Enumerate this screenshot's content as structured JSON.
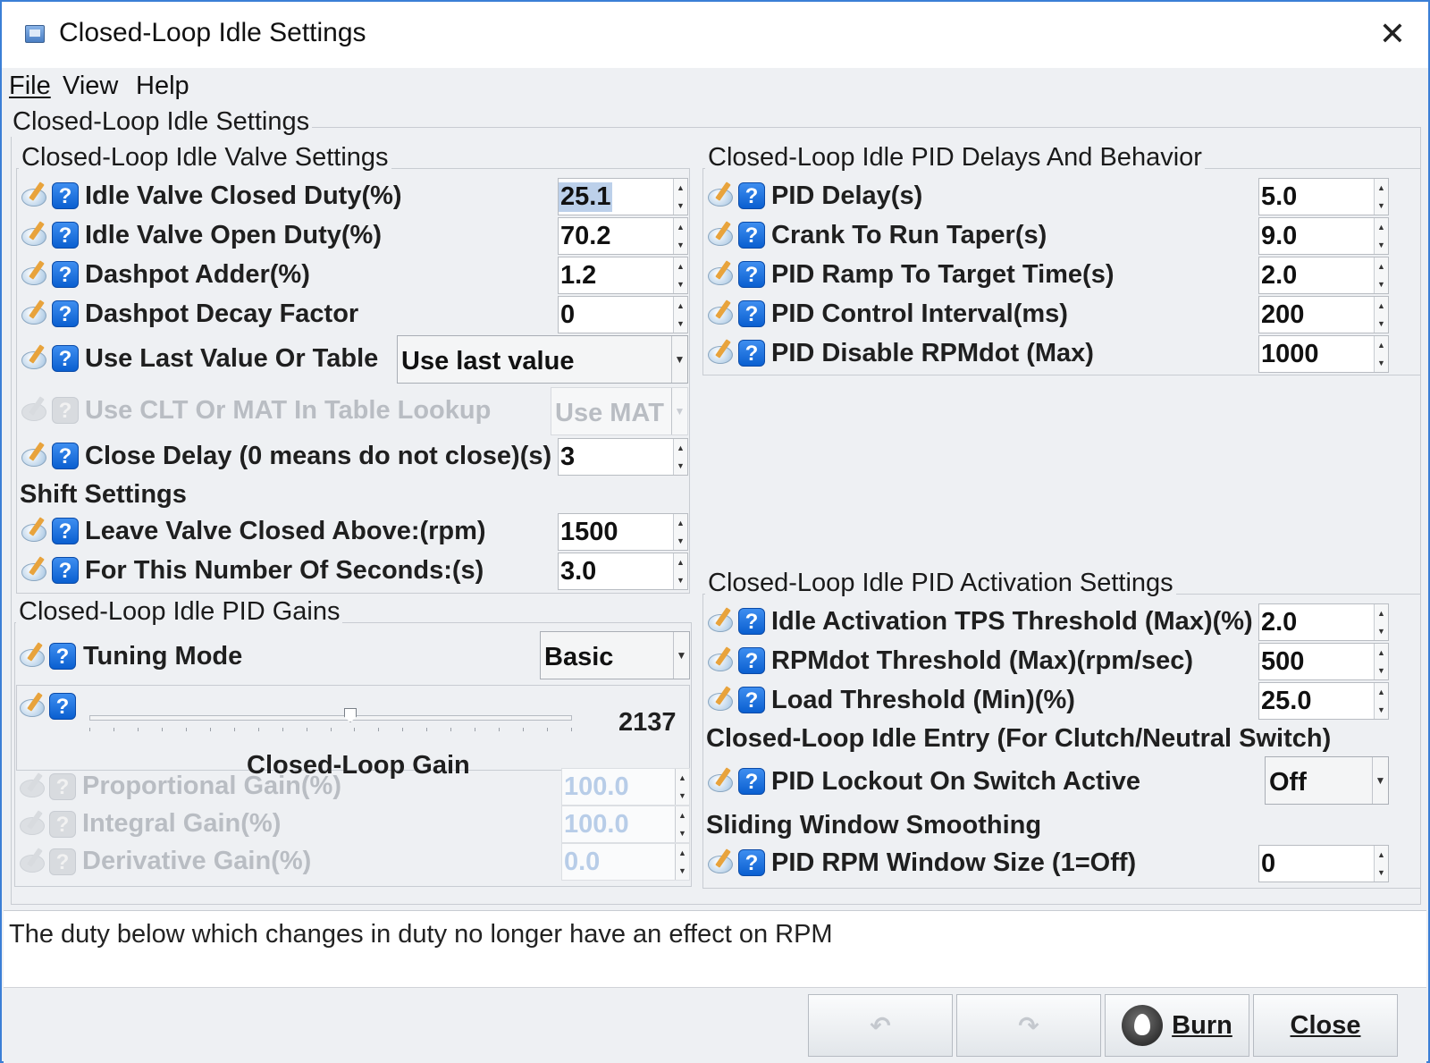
{
  "window": {
    "title": "Closed-Loop Idle Settings",
    "close_glyph": "✕"
  },
  "menu": {
    "file": "File",
    "view": "View",
    "help": "Help"
  },
  "outer_group_title": "Closed-Loop Idle Settings",
  "valve": {
    "title": "Closed-Loop Idle Valve Settings",
    "rows": [
      {
        "label": "Idle Valve Closed Duty(%)",
        "value": "25.1"
      },
      {
        "label": "Idle Valve Open Duty(%)",
        "value": "70.2"
      },
      {
        "label": "Dashpot Adder(%)",
        "value": "1.2"
      },
      {
        "label": "Dashpot Decay Factor",
        "value": "0"
      }
    ],
    "use_last": {
      "label": "Use Last Value Or Table",
      "value": "Use last value"
    },
    "clt_mat": {
      "label": "Use CLT Or MAT In Table Lookup",
      "value": "Use MAT"
    },
    "close_delay": {
      "label": "Close Delay (0 means do not close)(s)",
      "value": "3"
    },
    "shift_title": "Shift Settings",
    "shift_rows": [
      {
        "label": "Leave Valve Closed Above:(rpm)",
        "value": "1500"
      },
      {
        "label": "For This Number Of Seconds:(s)",
        "value": "3.0"
      }
    ]
  },
  "gains": {
    "title": "Closed-Loop Idle PID Gains",
    "tuning_mode": {
      "label": "Tuning Mode",
      "value": "Basic"
    },
    "slider": {
      "value": "2137",
      "caption": "Closed-Loop Gain",
      "fraction": 0.54
    },
    "rows": [
      {
        "label": "Proportional Gain(%)",
        "value": "100.0"
      },
      {
        "label": "Integral Gain(%)",
        "value": "100.0"
      },
      {
        "label": "Derivative Gain(%)",
        "value": "0.0"
      }
    ]
  },
  "delays": {
    "title": "Closed-Loop Idle PID Delays And Behavior",
    "rows": [
      {
        "label": "PID Delay(s)",
        "value": "5.0"
      },
      {
        "label": "Crank To Run Taper(s)",
        "value": "9.0"
      },
      {
        "label": "PID Ramp To Target Time(s)",
        "value": "2.0"
      },
      {
        "label": "PID Control Interval(ms)",
        "value": "200"
      },
      {
        "label": "PID Disable RPMdot (Max)",
        "value": "1000"
      }
    ]
  },
  "activation": {
    "title": "Closed-Loop Idle PID Activation Settings",
    "rows": [
      {
        "label": "Idle Activation TPS Threshold (Max)(%)",
        "value": "2.0"
      },
      {
        "label": "RPMdot Threshold (Max)(rpm/sec)",
        "value": "500"
      },
      {
        "label": "Load Threshold (Min)(%)",
        "value": "25.0"
      }
    ],
    "entry_title": "Closed-Loop Idle Entry (For Clutch/Neutral Switch)",
    "lockout": {
      "label": "PID Lockout On Switch Active",
      "value": "Off"
    },
    "smoothing_title": "Sliding Window Smoothing",
    "window": {
      "label": "PID RPM Window Size (1=Off)",
      "value": "0"
    }
  },
  "status": {
    "text": "The duty below which changes in duty no longer have an effect on RPM"
  },
  "buttons": {
    "undo": "↶",
    "redo": "↷",
    "burn": "Burn",
    "close": "Close"
  },
  "colors": {
    "accent": "#3b7fd6",
    "help_blue": "#0a5fd0",
    "selection": "#bcd0ea"
  }
}
